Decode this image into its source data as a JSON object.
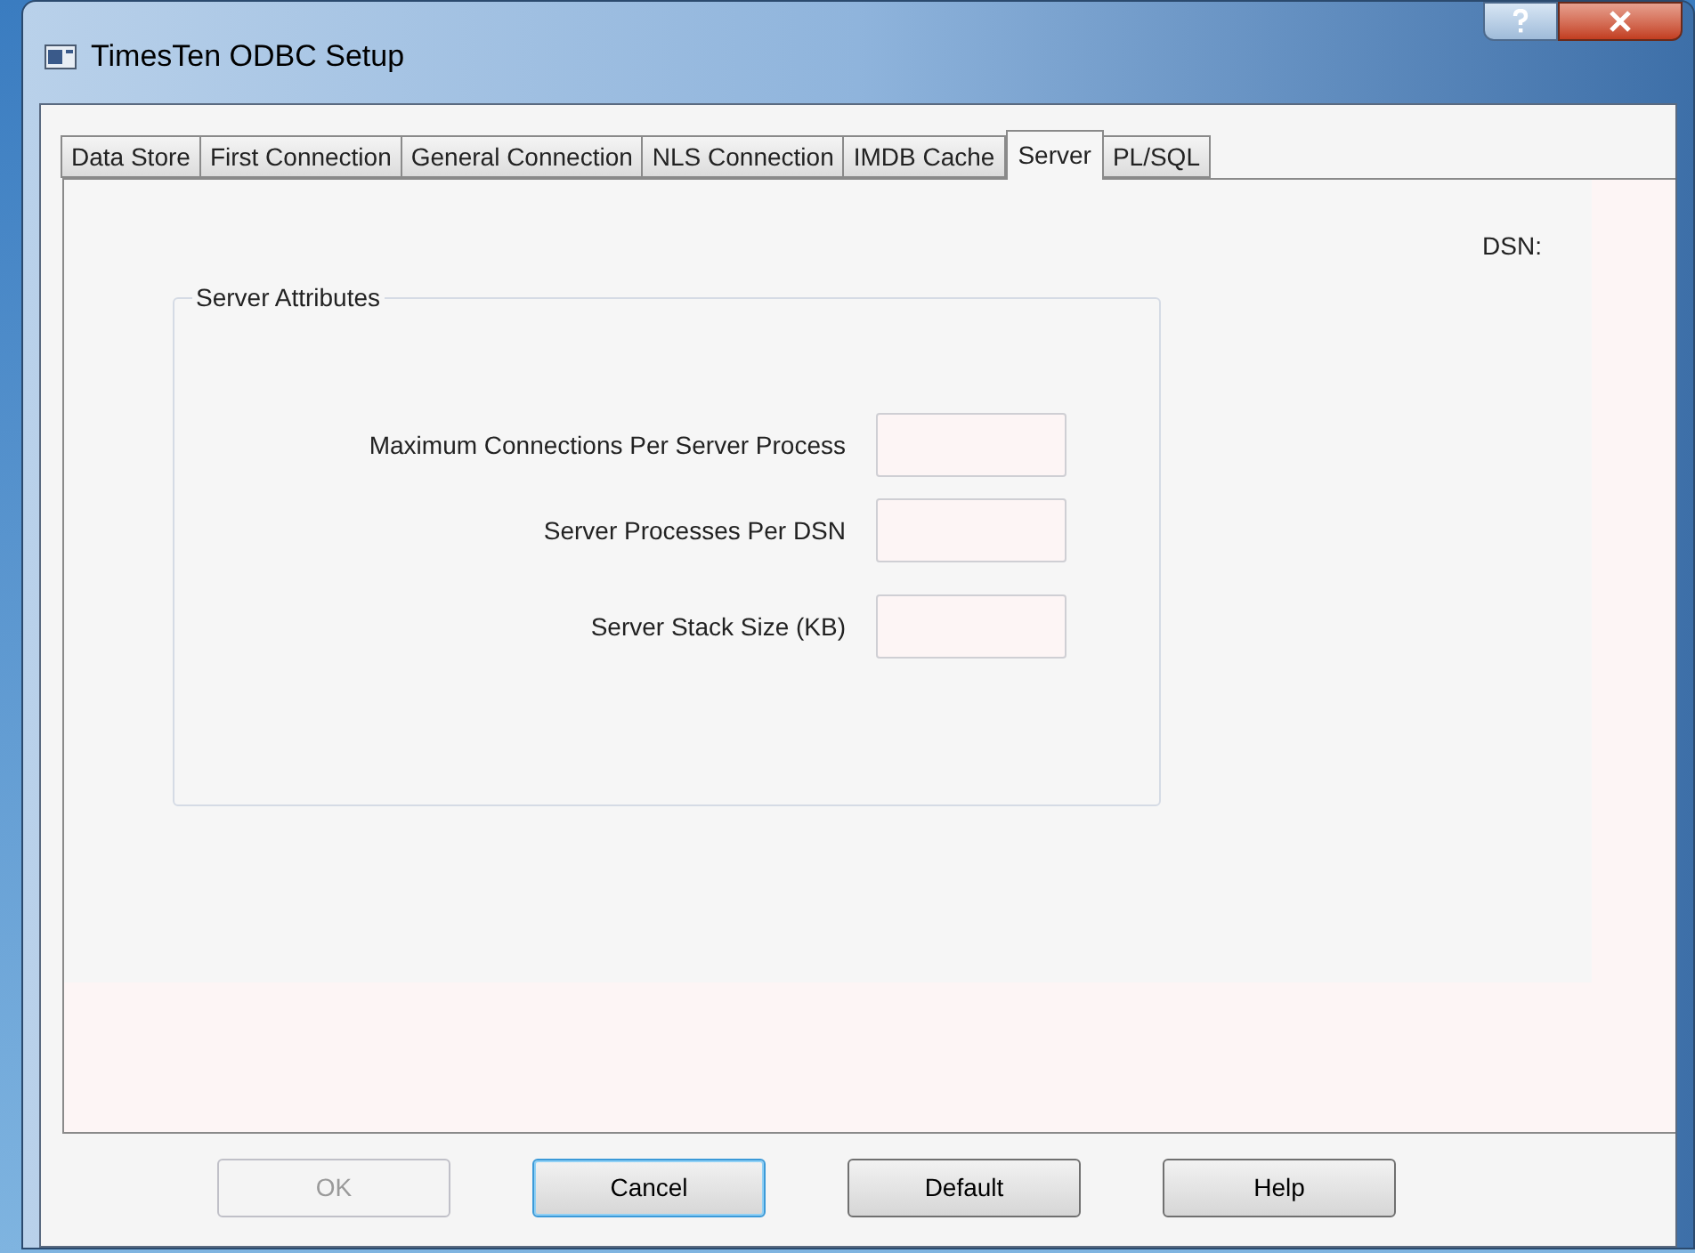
{
  "window": {
    "title": "TimesTen ODBC Setup"
  },
  "tabs": [
    {
      "label": "Data Store",
      "selected": false
    },
    {
      "label": "First Connection",
      "selected": false
    },
    {
      "label": "General Connection",
      "selected": false
    },
    {
      "label": "NLS Connection",
      "selected": false
    },
    {
      "label": "IMDB Cache",
      "selected": false
    },
    {
      "label": "Server",
      "selected": true
    },
    {
      "label": "PL/SQL",
      "selected": false
    }
  ],
  "dsn_label": "DSN:",
  "group": {
    "title": "Server Attributes",
    "fields": [
      {
        "label": "Maximum Connections Per Server Process"
      },
      {
        "label": "Server Processes Per DSN"
      },
      {
        "label": "Server Stack Size (KB)"
      }
    ]
  },
  "buttons": [
    {
      "label": "OK",
      "disabled": true,
      "default": false
    },
    {
      "label": "Cancel",
      "disabled": false,
      "default": true
    },
    {
      "label": "Default",
      "disabled": false,
      "default": false
    },
    {
      "label": "Help",
      "disabled": false,
      "default": false
    }
  ]
}
